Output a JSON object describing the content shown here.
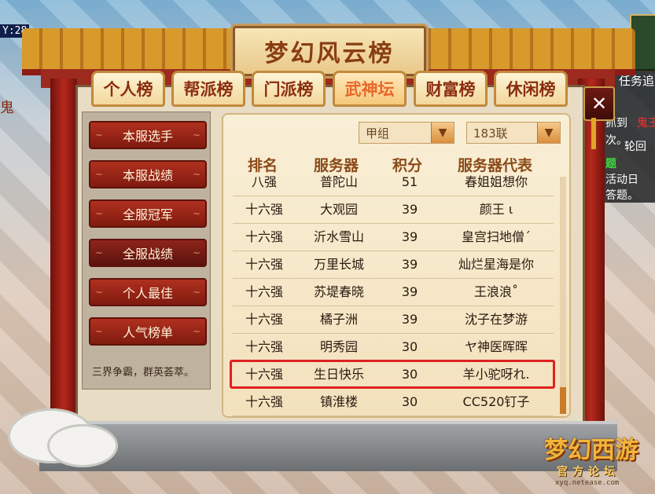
{
  "hud": {
    "coord_text": "Y:28",
    "left_glyph": "鬼",
    "task_label": "任务追",
    "right_lines": [
      {
        "text": "抓到",
        "style": "white"
      },
      {
        "text": "鬼王",
        "style": "red"
      },
      {
        "text": "次。",
        "style": "white"
      },
      {
        "text": "轮回",
        "style": "white"
      },
      {
        "text": "题",
        "style": "green"
      },
      {
        "text": "活动日",
        "style": "white"
      },
      {
        "text": "答题。",
        "style": "white"
      }
    ]
  },
  "window": {
    "title": "梦幻风云榜",
    "close_label": "✕"
  },
  "tabs": [
    {
      "label": "个人榜",
      "active": false
    },
    {
      "label": "帮派榜",
      "active": false
    },
    {
      "label": "门派榜",
      "active": false
    },
    {
      "label": "武神坛",
      "active": true
    },
    {
      "label": "财富榜",
      "active": false
    },
    {
      "label": "休闲榜",
      "active": false
    }
  ],
  "menu": [
    {
      "label": "本服选手",
      "active": false
    },
    {
      "label": "本服战绩",
      "active": false
    },
    {
      "label": "全服冠军",
      "active": false
    },
    {
      "label": "全服战绩",
      "active": true
    },
    {
      "label": "个人最佳",
      "active": false
    },
    {
      "label": "人气榜单",
      "active": false
    }
  ],
  "slogan": "三界争霸，群英荟萃。",
  "filters": {
    "group": "甲组",
    "alliance": "183联"
  },
  "table": {
    "headers": [
      "排名",
      "服务器",
      "积分",
      "服务器代表"
    ],
    "rows": [
      {
        "rank": "八强",
        "server": "普陀山",
        "score": "51",
        "rep": "春姐姐想你"
      },
      {
        "rank": "十六强",
        "server": "大观园",
        "score": "39",
        "rep": "颜王 ι"
      },
      {
        "rank": "十六强",
        "server": "沂水雪山",
        "score": "39",
        "rep": "皇宫扫地僧ˊ"
      },
      {
        "rank": "十六强",
        "server": "万里长城",
        "score": "39",
        "rep": "灿烂星海是你"
      },
      {
        "rank": "十六强",
        "server": "苏堤春晓",
        "score": "39",
        "rep": "王浪浪˚"
      },
      {
        "rank": "十六强",
        "server": "橘子洲",
        "score": "39",
        "rep": "沈子在梦游"
      },
      {
        "rank": "十六强",
        "server": "明秀园",
        "score": "30",
        "rep": "ヤ神医晖晖"
      },
      {
        "rank": "十六强",
        "server": "生日快乐",
        "score": "30",
        "rep": "羊小驼呀れ.",
        "highlighted": true
      },
      {
        "rank": "十六强",
        "server": "镇淮楼",
        "score": "30",
        "rep": "CC520钉子"
      }
    ]
  },
  "logo": {
    "main": "梦幻西游",
    "sub": "官方论坛",
    "url": "xyq.netease.com"
  }
}
